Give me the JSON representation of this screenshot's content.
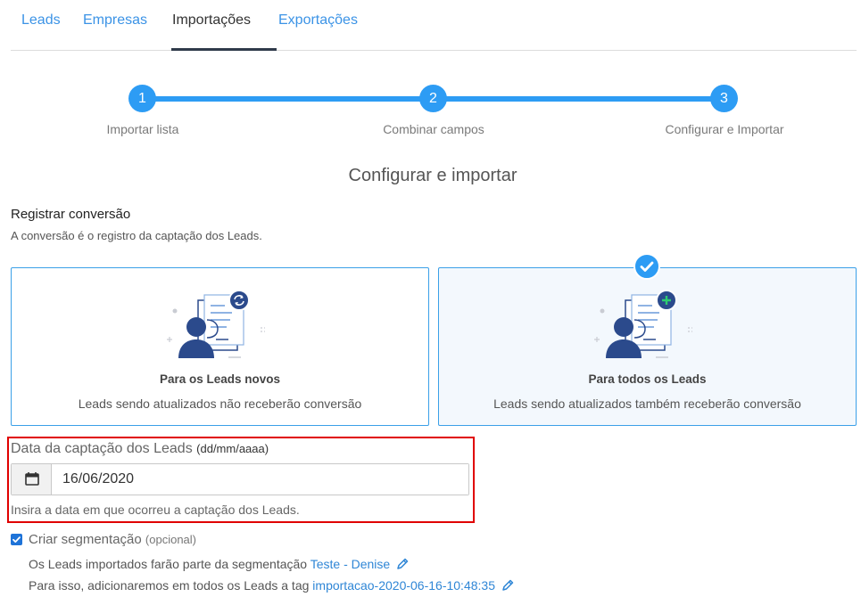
{
  "tabs": [
    {
      "label": "Leads"
    },
    {
      "label": "Empresas"
    },
    {
      "label": "Importações"
    },
    {
      "label": "Exportações"
    }
  ],
  "stepper": {
    "steps": [
      {
        "number": "1",
        "label": "Importar lista"
      },
      {
        "number": "2",
        "label": "Combinar campos"
      },
      {
        "number": "3",
        "label": "Configurar e Importar"
      }
    ],
    "current_step": 3
  },
  "section_title": "Configurar e importar",
  "conversion": {
    "title": "Registrar conversão",
    "subtitle": "A conversão é o registro da captação dos Leads.",
    "options": [
      {
        "title": "Para os Leads novos",
        "description": "Leads sendo atualizados não receberão conversão",
        "badge_icon": "refresh-icon",
        "selected": false
      },
      {
        "title": "Para todos os Leads",
        "description": "Leads sendo atualizados também receberão conversão",
        "badge_icon": "plus-icon",
        "selected": true
      }
    ]
  },
  "capture_date": {
    "label": "Data da captação dos Leads",
    "format_hint": "(dd/mm/aaaa)",
    "value": "16/06/2020",
    "help": "Insira a data em que ocorreu a captação dos Leads."
  },
  "segmentation": {
    "checked": true,
    "label": "Criar segmentação",
    "optional": "(opcional)",
    "segment_text": "Os Leads importados farão parte da segmentação",
    "segment_name": "Teste - Denise",
    "tag_text": "Para isso, adicionaremos em todos os Leads a tag",
    "tag_name": "importacao-2020-06-16-10:48:35"
  },
  "colors": {
    "accent": "#2d9cf4",
    "link": "#3b93e6",
    "highlight_border": "#e00000",
    "illustration_navy": "#2b4a8c"
  }
}
